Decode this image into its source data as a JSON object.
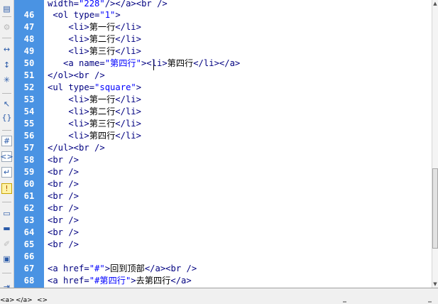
{
  "toolbar": {
    "icons": [
      "open-files-icon",
      "show-code-navigator-icon",
      "collapse-full-tag-icon",
      "collapse-selection-icon",
      "expand-all-icon",
      "select-parent-tag-icon",
      "balance-braces-icon",
      "line-numbers-icon",
      "highlight-invalid-code-icon",
      "word-wrap-icon",
      "syntax-error-alerts-icon",
      "apply-comment-icon",
      "remove-comment-icon",
      "wrap-tag-icon",
      "recent-snippets-icon",
      "indent-code-icon"
    ]
  },
  "editor": {
    "lines": [
      {
        "n": "46",
        "tokens": [
          {
            "t": " <ol type=",
            "k": "tag"
          },
          {
            "t": "\"1\"",
            "k": "val"
          },
          {
            "t": ">",
            "k": "tag"
          }
        ]
      },
      {
        "n": "47",
        "tokens": [
          {
            "t": "    <li>",
            "k": "tag"
          },
          {
            "t": "第一行",
            "k": "txt"
          },
          {
            "t": "</li>",
            "k": "tag"
          }
        ]
      },
      {
        "n": "48",
        "tokens": [
          {
            "t": "    <li>",
            "k": "tag"
          },
          {
            "t": "第二行",
            "k": "txt"
          },
          {
            "t": "</li>",
            "k": "tag"
          }
        ]
      },
      {
        "n": "49",
        "tokens": [
          {
            "t": "    <li>",
            "k": "tag"
          },
          {
            "t": "第三行",
            "k": "txt"
          },
          {
            "t": "</li>",
            "k": "tag"
          }
        ]
      },
      {
        "n": "50",
        "tokens": [
          {
            "t": "   <a name=",
            "k": "tag"
          },
          {
            "t": "\"第四行\"",
            "k": "val"
          },
          {
            "t": "><li>",
            "k": "tag"
          },
          {
            "t": "第四行",
            "k": "txt"
          },
          {
            "t": "</li></a>",
            "k": "tag"
          }
        ]
      },
      {
        "n": "51",
        "tokens": [
          {
            "t": "</ol><br />",
            "k": "tag"
          }
        ]
      },
      {
        "n": "52",
        "tokens": [
          {
            "t": "<ul type=",
            "k": "tag"
          },
          {
            "t": "\"square\"",
            "k": "val"
          },
          {
            "t": ">",
            "k": "tag"
          }
        ]
      },
      {
        "n": "53",
        "tokens": [
          {
            "t": "    <li>",
            "k": "tag"
          },
          {
            "t": "第一行",
            "k": "txt"
          },
          {
            "t": "</li>",
            "k": "tag"
          }
        ]
      },
      {
        "n": "54",
        "tokens": [
          {
            "t": "    <li>",
            "k": "tag"
          },
          {
            "t": "第二行",
            "k": "txt"
          },
          {
            "t": "</li>",
            "k": "tag"
          }
        ]
      },
      {
        "n": "55",
        "tokens": [
          {
            "t": "    <li>",
            "k": "tag"
          },
          {
            "t": "第三行",
            "k": "txt"
          },
          {
            "t": "</li>",
            "k": "tag"
          }
        ]
      },
      {
        "n": "56",
        "tokens": [
          {
            "t": "    <li>",
            "k": "tag"
          },
          {
            "t": "第四行",
            "k": "txt"
          },
          {
            "t": "</li>",
            "k": "tag"
          }
        ]
      },
      {
        "n": "57",
        "tokens": [
          {
            "t": "</ul><br />",
            "k": "tag"
          }
        ]
      },
      {
        "n": "58",
        "tokens": [
          {
            "t": "<br />",
            "k": "tag"
          }
        ]
      },
      {
        "n": "59",
        "tokens": [
          {
            "t": "<br />",
            "k": "tag"
          }
        ]
      },
      {
        "n": "60",
        "tokens": [
          {
            "t": "<br />",
            "k": "tag"
          }
        ]
      },
      {
        "n": "61",
        "tokens": [
          {
            "t": "<br />",
            "k": "tag"
          }
        ]
      },
      {
        "n": "62",
        "tokens": [
          {
            "t": "<br />",
            "k": "tag"
          }
        ]
      },
      {
        "n": "63",
        "tokens": [
          {
            "t": "<br />",
            "k": "tag"
          }
        ]
      },
      {
        "n": "64",
        "tokens": [
          {
            "t": "<br />",
            "k": "tag"
          }
        ]
      },
      {
        "n": "65",
        "tokens": [
          {
            "t": "<br />",
            "k": "tag"
          }
        ]
      },
      {
        "n": "66",
        "tokens": []
      },
      {
        "n": "67",
        "tokens": [
          {
            "t": "<a href=",
            "k": "tag"
          },
          {
            "t": "\"#\"",
            "k": "val"
          },
          {
            "t": ">",
            "k": "tag"
          },
          {
            "t": "回到顶部",
            "k": "txt"
          },
          {
            "t": "</a><br />",
            "k": "tag"
          }
        ]
      },
      {
        "n": "68",
        "tokens": [
          {
            "t": "<a href=",
            "k": "tag"
          },
          {
            "t": "\"#第四行\"",
            "k": "val"
          },
          {
            "t": ">",
            "k": "tag"
          },
          {
            "t": "去第四行",
            "k": "txt"
          },
          {
            "t": "</a>",
            "k": "tag"
          }
        ]
      }
    ],
    "partial_top_line": [
      {
        "t": "width=",
        "k": "tag"
      },
      {
        "t": "\"228\"",
        "k": "val"
      },
      {
        "t": "/></a><br />",
        "k": "tag"
      }
    ]
  },
  "status_bar": {
    "tag_selector": [
      "<a>",
      "</a>",
      "<>"
    ]
  },
  "colors": {
    "gutter": "#4a93e3",
    "tag": "#000080",
    "attribute_value": "#0000ff",
    "text": "#000000"
  }
}
